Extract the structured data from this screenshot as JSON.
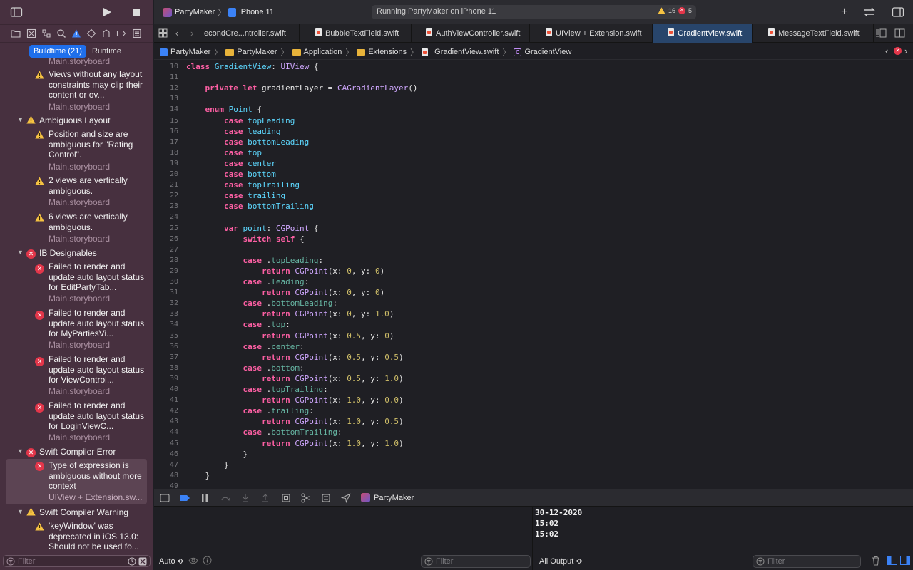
{
  "sidebar": {
    "segments": {
      "active": "Buildtime (21)",
      "inactive": "Runtime"
    },
    "truncated_top_file": "Main.storyboard",
    "groups": [
      {
        "title": "Ambiguous Layout"
      },
      {
        "title": "IB Designables"
      },
      {
        "title": "Swift Compiler Error"
      },
      {
        "title": "Swift Compiler Warning"
      }
    ],
    "issues": [
      {
        "text": "Views without any layout constraints may clip their content or ov...",
        "file": "Main.storyboard"
      },
      {
        "text": "Position and size are ambiguous for \"Rating Control\".",
        "file": "Main.storyboard"
      },
      {
        "text": "2 views are vertically ambiguous.",
        "file": "Main.storyboard"
      },
      {
        "text": "6 views are vertically ambiguous.",
        "file": "Main.storyboard"
      },
      {
        "text": "Failed to render and update auto layout status for EditPartyTab...",
        "file": "Main.storyboard"
      },
      {
        "text": "Failed to render and update auto layout status for MyPartiesVi...",
        "file": "Main.storyboard"
      },
      {
        "text": "Failed to render and update auto layout status for ViewControl...",
        "file": "Main.storyboard"
      },
      {
        "text": "Failed to render and update auto layout status for LoginViewC...",
        "file": "Main.storyboard"
      },
      {
        "text": "Type of expression is ambiguous without more context",
        "file": "UIView + Extension.sw..."
      },
      {
        "text": "'keyWindow' was deprecated in iOS 13.0: Should not be used fo..."
      }
    ],
    "filter_placeholder": "Filter"
  },
  "toolbar": {
    "scheme": "PartyMaker",
    "device": "iPhone 11",
    "activity": "Running PartyMaker on iPhone 11",
    "warnings": "16",
    "errors": "5"
  },
  "tabs": [
    "econdCre...ntroller.swift",
    "BubbleTextField.swift",
    "AuthViewController.swift",
    "UIView + Extension.swift",
    "GradientView.swift",
    "MessageTextField.swift"
  ],
  "breadcrumb": [
    "PartyMaker",
    "PartyMaker",
    "Application",
    "Extensions",
    "GradientView.swift",
    "GradientView"
  ],
  "code": [
    {
      "n": "10",
      "t": [
        [
          "kw",
          "class "
        ],
        [
          "ty",
          "GradientView"
        ],
        [
          "plain",
          ": "
        ],
        [
          "cy",
          "UIView"
        ],
        [
          "plain",
          " {"
        ]
      ]
    },
    {
      "n": "11",
      "t": []
    },
    {
      "n": "12",
      "t": [
        [
          "plain",
          "    "
        ],
        [
          "kw",
          "private let "
        ],
        [
          "plain",
          "gradientLayer = "
        ],
        [
          "cy",
          "CAGradientLayer"
        ],
        [
          "plain",
          "()"
        ]
      ]
    },
    {
      "n": "13",
      "t": []
    },
    {
      "n": "14",
      "t": [
        [
          "plain",
          "    "
        ],
        [
          "kw",
          "enum "
        ],
        [
          "ty",
          "Point"
        ],
        [
          "plain",
          " {"
        ]
      ]
    },
    {
      "n": "15",
      "t": [
        [
          "plain",
          "        "
        ],
        [
          "kw",
          "case "
        ],
        [
          "ty",
          "topLeading"
        ]
      ]
    },
    {
      "n": "16",
      "t": [
        [
          "plain",
          "        "
        ],
        [
          "kw",
          "case "
        ],
        [
          "ty",
          "leading"
        ]
      ]
    },
    {
      "n": "17",
      "t": [
        [
          "plain",
          "        "
        ],
        [
          "kw",
          "case "
        ],
        [
          "ty",
          "bottomLeading"
        ]
      ]
    },
    {
      "n": "18",
      "t": [
        [
          "plain",
          "        "
        ],
        [
          "kw",
          "case "
        ],
        [
          "ty",
          "top"
        ]
      ]
    },
    {
      "n": "19",
      "t": [
        [
          "plain",
          "        "
        ],
        [
          "kw",
          "case "
        ],
        [
          "ty",
          "center"
        ]
      ]
    },
    {
      "n": "20",
      "t": [
        [
          "plain",
          "        "
        ],
        [
          "kw",
          "case "
        ],
        [
          "ty",
          "bottom"
        ]
      ]
    },
    {
      "n": "21",
      "t": [
        [
          "plain",
          "        "
        ],
        [
          "kw",
          "case "
        ],
        [
          "ty",
          "topTrailing"
        ]
      ]
    },
    {
      "n": "22",
      "t": [
        [
          "plain",
          "        "
        ],
        [
          "kw",
          "case "
        ],
        [
          "ty",
          "trailing"
        ]
      ]
    },
    {
      "n": "23",
      "t": [
        [
          "plain",
          "        "
        ],
        [
          "kw",
          "case "
        ],
        [
          "ty",
          "bottomTrailing"
        ]
      ]
    },
    {
      "n": "24",
      "t": []
    },
    {
      "n": "25",
      "t": [
        [
          "plain",
          "        "
        ],
        [
          "kw",
          "var "
        ],
        [
          "ty",
          "point"
        ],
        [
          "plain",
          ": "
        ],
        [
          "cy",
          "CGPoint"
        ],
        [
          "plain",
          " {"
        ]
      ]
    },
    {
      "n": "26",
      "t": [
        [
          "plain",
          "            "
        ],
        [
          "kw",
          "switch self"
        ],
        [
          "plain",
          " {"
        ]
      ]
    },
    {
      "n": "27",
      "t": []
    },
    {
      "n": "28",
      "t": [
        [
          "plain",
          "            "
        ],
        [
          "kw",
          "case "
        ],
        [
          "plain",
          "."
        ],
        [
          "cs",
          "topLeading"
        ],
        [
          "plain",
          ":"
        ]
      ]
    },
    {
      "n": "29",
      "t": [
        [
          "plain",
          "                "
        ],
        [
          "kw",
          "return "
        ],
        [
          "cy",
          "CGPoint"
        ],
        [
          "plain",
          "(x: "
        ],
        [
          "num",
          "0"
        ],
        [
          "plain",
          ", y: "
        ],
        [
          "num",
          "0"
        ],
        [
          "plain",
          ")"
        ]
      ]
    },
    {
      "n": "30",
      "t": [
        [
          "plain",
          "            "
        ],
        [
          "kw",
          "case "
        ],
        [
          "plain",
          "."
        ],
        [
          "cs",
          "leading"
        ],
        [
          "plain",
          ":"
        ]
      ]
    },
    {
      "n": "31",
      "t": [
        [
          "plain",
          "                "
        ],
        [
          "kw",
          "return "
        ],
        [
          "cy",
          "CGPoint"
        ],
        [
          "plain",
          "(x: "
        ],
        [
          "num",
          "0"
        ],
        [
          "plain",
          ", y: "
        ],
        [
          "num",
          "0"
        ],
        [
          "plain",
          ")"
        ]
      ]
    },
    {
      "n": "32",
      "t": [
        [
          "plain",
          "            "
        ],
        [
          "kw",
          "case "
        ],
        [
          "plain",
          "."
        ],
        [
          "cs",
          "bottomLeading"
        ],
        [
          "plain",
          ":"
        ]
      ]
    },
    {
      "n": "33",
      "t": [
        [
          "plain",
          "                "
        ],
        [
          "kw",
          "return "
        ],
        [
          "cy",
          "CGPoint"
        ],
        [
          "plain",
          "(x: "
        ],
        [
          "num",
          "0"
        ],
        [
          "plain",
          ", y: "
        ],
        [
          "num",
          "1.0"
        ],
        [
          "plain",
          ")"
        ]
      ]
    },
    {
      "n": "34",
      "t": [
        [
          "plain",
          "            "
        ],
        [
          "kw",
          "case "
        ],
        [
          "plain",
          "."
        ],
        [
          "cs",
          "top"
        ],
        [
          "plain",
          ":"
        ]
      ]
    },
    {
      "n": "35",
      "t": [
        [
          "plain",
          "                "
        ],
        [
          "kw",
          "return "
        ],
        [
          "cy",
          "CGPoint"
        ],
        [
          "plain",
          "(x: "
        ],
        [
          "num",
          "0.5"
        ],
        [
          "plain",
          ", y: "
        ],
        [
          "num",
          "0"
        ],
        [
          "plain",
          ")"
        ]
      ]
    },
    {
      "n": "36",
      "t": [
        [
          "plain",
          "            "
        ],
        [
          "kw",
          "case "
        ],
        [
          "plain",
          "."
        ],
        [
          "cs",
          "center"
        ],
        [
          "plain",
          ":"
        ]
      ]
    },
    {
      "n": "37",
      "t": [
        [
          "plain",
          "                "
        ],
        [
          "kw",
          "return "
        ],
        [
          "cy",
          "CGPoint"
        ],
        [
          "plain",
          "(x: "
        ],
        [
          "num",
          "0.5"
        ],
        [
          "plain",
          ", y: "
        ],
        [
          "num",
          "0.5"
        ],
        [
          "plain",
          ")"
        ]
      ]
    },
    {
      "n": "38",
      "t": [
        [
          "plain",
          "            "
        ],
        [
          "kw",
          "case "
        ],
        [
          "plain",
          "."
        ],
        [
          "cs",
          "bottom"
        ],
        [
          "plain",
          ":"
        ]
      ]
    },
    {
      "n": "39",
      "t": [
        [
          "plain",
          "                "
        ],
        [
          "kw",
          "return "
        ],
        [
          "cy",
          "CGPoint"
        ],
        [
          "plain",
          "(x: "
        ],
        [
          "num",
          "0.5"
        ],
        [
          "plain",
          ", y: "
        ],
        [
          "num",
          "1.0"
        ],
        [
          "plain",
          ")"
        ]
      ]
    },
    {
      "n": "40",
      "t": [
        [
          "plain",
          "            "
        ],
        [
          "kw",
          "case "
        ],
        [
          "plain",
          "."
        ],
        [
          "cs",
          "topTrailing"
        ],
        [
          "plain",
          ":"
        ]
      ]
    },
    {
      "n": "41",
      "t": [
        [
          "plain",
          "                "
        ],
        [
          "kw",
          "return "
        ],
        [
          "cy",
          "CGPoint"
        ],
        [
          "plain",
          "(x: "
        ],
        [
          "num",
          "1.0"
        ],
        [
          "plain",
          ", y: "
        ],
        [
          "num",
          "0.0"
        ],
        [
          "plain",
          ")"
        ]
      ]
    },
    {
      "n": "42",
      "t": [
        [
          "plain",
          "            "
        ],
        [
          "kw",
          "case "
        ],
        [
          "plain",
          "."
        ],
        [
          "cs",
          "trailing"
        ],
        [
          "plain",
          ":"
        ]
      ]
    },
    {
      "n": "43",
      "t": [
        [
          "plain",
          "                "
        ],
        [
          "kw",
          "return "
        ],
        [
          "cy",
          "CGPoint"
        ],
        [
          "plain",
          "(x: "
        ],
        [
          "num",
          "1.0"
        ],
        [
          "plain",
          ", y: "
        ],
        [
          "num",
          "0.5"
        ],
        [
          "plain",
          ")"
        ]
      ]
    },
    {
      "n": "44",
      "t": [
        [
          "plain",
          "            "
        ],
        [
          "kw",
          "case "
        ],
        [
          "plain",
          "."
        ],
        [
          "cs",
          "bottomTrailing"
        ],
        [
          "plain",
          ":"
        ]
      ]
    },
    {
      "n": "45",
      "t": [
        [
          "plain",
          "                "
        ],
        [
          "kw",
          "return "
        ],
        [
          "cy",
          "CGPoint"
        ],
        [
          "plain",
          "(x: "
        ],
        [
          "num",
          "1.0"
        ],
        [
          "plain",
          ", y: "
        ],
        [
          "num",
          "1.0"
        ],
        [
          "plain",
          ")"
        ]
      ]
    },
    {
      "n": "46",
      "t": [
        [
          "plain",
          "            }"
        ]
      ]
    },
    {
      "n": "47",
      "t": [
        [
          "plain",
          "        }"
        ]
      ]
    },
    {
      "n": "48",
      "t": [
        [
          "plain",
          "    }"
        ]
      ]
    },
    {
      "n": "49",
      "t": []
    }
  ],
  "debug": {
    "process": "PartyMaker",
    "vars_mode": "Auto ≎",
    "filter_placeholder": "Filter",
    "output_mode": "All Output ≎",
    "console": [
      "30-12-2020",
      "15:02",
      "15:02"
    ]
  },
  "colors": {
    "sidebar_bg": "#47303f",
    "editor_bg": "#1f1f24",
    "active_tab": "#28456b",
    "keyword": "#fc5fa3",
    "type": "#5dd8ff",
    "number": "#d0bf69",
    "error": "#e2364a",
    "warning": "#f5c242"
  }
}
